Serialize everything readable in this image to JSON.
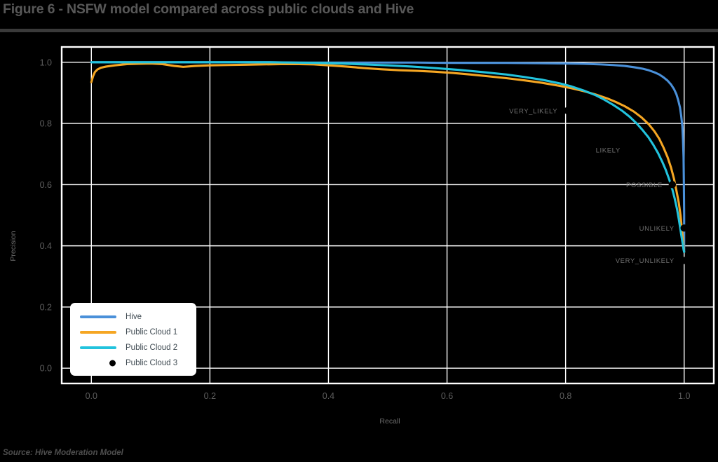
{
  "figure": {
    "title": "Figure 6 - NSFW model compared across public clouds and Hive",
    "source": "Source: Hive Moderation Model"
  },
  "colors": {
    "hive": "#4a90d9",
    "public_cloud_1": "#f5a623",
    "public_cloud_2": "#22c3dd",
    "public_cloud_3": "#000000",
    "background": "#000000",
    "axis": "#ffffff",
    "title_text": "#585858",
    "tick_text": "#5e5e5e",
    "annotation_text": "#707070",
    "legend_background": "#ffffff",
    "legend_text": "#3f4a52"
  },
  "legend": {
    "position": "lower-left",
    "entries": [
      {
        "label": "Hive",
        "marker": "line",
        "color": "#4a90d9"
      },
      {
        "label": "Public Cloud 1",
        "marker": "line",
        "color": "#f5a623"
      },
      {
        "label": "Public Cloud 2",
        "marker": "line",
        "color": "#22c3dd"
      },
      {
        "label": "Public Cloud 3",
        "marker": "dot",
        "color": "#000000"
      }
    ]
  },
  "chart_data": {
    "type": "line",
    "title": "Figure 6 - NSFW model compared across public clouds and Hive",
    "subtitle": "",
    "xlabel": "Recall",
    "ylabel": "Precision",
    "xlim": [
      -0.05,
      1.05
    ],
    "ylim": [
      -0.05,
      1.05
    ],
    "xticks": [
      "0.0",
      "0.2",
      "0.4",
      "0.6",
      "0.8",
      "1.0"
    ],
    "xtick_values": [
      0.0,
      0.2,
      0.4,
      0.6,
      0.8,
      1.0
    ],
    "yticks": [
      "0.0",
      "0.2",
      "0.4",
      "0.6",
      "0.8",
      "1.0"
    ],
    "ytick_values": [
      0.0,
      0.2,
      0.4,
      0.6,
      0.8,
      1.0
    ],
    "grid": true,
    "grid_color": "#ffffff",
    "legend_position": "lower left",
    "series": [
      {
        "name": "Hive",
        "color": "#4a90d9",
        "type": "line",
        "points": [
          [
            0.0,
            1.0
          ],
          [
            0.05,
            1.0
          ],
          [
            0.1,
            1.0
          ],
          [
            0.15,
            1.0
          ],
          [
            0.2,
            1.0
          ],
          [
            0.25,
            1.0
          ],
          [
            0.3,
            1.0
          ],
          [
            0.35,
            0.999
          ],
          [
            0.4,
            0.999
          ],
          [
            0.45,
            0.999
          ],
          [
            0.5,
            0.999
          ],
          [
            0.55,
            0.999
          ],
          [
            0.6,
            0.998
          ],
          [
            0.65,
            0.998
          ],
          [
            0.7,
            0.998
          ],
          [
            0.75,
            0.997
          ],
          [
            0.8,
            0.996
          ],
          [
            0.83,
            0.995
          ],
          [
            0.86,
            0.993
          ],
          [
            0.88,
            0.991
          ],
          [
            0.9,
            0.988
          ],
          [
            0.915,
            0.984
          ],
          [
            0.93,
            0.979
          ],
          [
            0.94,
            0.974
          ],
          [
            0.95,
            0.967
          ],
          [
            0.958,
            0.96
          ],
          [
            0.965,
            0.951
          ],
          [
            0.972,
            0.94
          ],
          [
            0.978,
            0.927
          ],
          [
            0.983,
            0.912
          ],
          [
            0.987,
            0.895
          ],
          [
            0.99,
            0.876
          ],
          [
            0.993,
            0.852
          ],
          [
            0.995,
            0.825
          ],
          [
            0.997,
            0.79
          ],
          [
            0.998,
            0.748
          ],
          [
            0.999,
            0.69
          ],
          [
            0.9995,
            0.61
          ],
          [
            1.0,
            0.5
          ],
          [
            1.0,
            0.38
          ]
        ]
      },
      {
        "name": "Public Cloud 1",
        "color": "#f5a623",
        "type": "line",
        "points": [
          [
            0.0,
            0.935
          ],
          [
            0.003,
            0.955
          ],
          [
            0.006,
            0.968
          ],
          [
            0.01,
            0.976
          ],
          [
            0.016,
            0.982
          ],
          [
            0.025,
            0.986
          ],
          [
            0.04,
            0.99
          ],
          [
            0.06,
            0.994
          ],
          [
            0.08,
            0.995
          ],
          [
            0.1,
            0.996
          ],
          [
            0.12,
            0.994
          ],
          [
            0.14,
            0.988
          ],
          [
            0.155,
            0.985
          ],
          [
            0.175,
            0.988
          ],
          [
            0.2,
            0.99
          ],
          [
            0.23,
            0.991
          ],
          [
            0.26,
            0.992
          ],
          [
            0.29,
            0.993
          ],
          [
            0.32,
            0.994
          ],
          [
            0.35,
            0.994
          ],
          [
            0.375,
            0.993
          ],
          [
            0.4,
            0.99
          ],
          [
            0.43,
            0.986
          ],
          [
            0.46,
            0.981
          ],
          [
            0.49,
            0.977
          ],
          [
            0.52,
            0.974
          ],
          [
            0.55,
            0.972
          ],
          [
            0.58,
            0.969
          ],
          [
            0.61,
            0.965
          ],
          [
            0.64,
            0.96
          ],
          [
            0.67,
            0.954
          ],
          [
            0.7,
            0.948
          ],
          [
            0.73,
            0.941
          ],
          [
            0.76,
            0.933
          ],
          [
            0.79,
            0.923
          ],
          [
            0.81,
            0.915
          ],
          [
            0.83,
            0.906
          ],
          [
            0.85,
            0.895
          ],
          [
            0.87,
            0.882
          ],
          [
            0.885,
            0.87
          ],
          [
            0.9,
            0.856
          ],
          [
            0.915,
            0.839
          ],
          [
            0.928,
            0.82
          ],
          [
            0.94,
            0.798
          ],
          [
            0.95,
            0.774
          ],
          [
            0.958,
            0.75
          ],
          [
            0.965,
            0.722
          ],
          [
            0.972,
            0.69
          ],
          [
            0.978,
            0.655
          ],
          [
            0.983,
            0.618
          ],
          [
            0.987,
            0.58
          ],
          [
            0.991,
            0.54
          ],
          [
            0.994,
            0.498
          ],
          [
            0.996,
            0.458
          ],
          [
            0.998,
            0.42
          ],
          [
            0.999,
            0.395
          ],
          [
            1.0,
            0.38
          ]
        ]
      },
      {
        "name": "Public Cloud 2",
        "color": "#22c3dd",
        "type": "line",
        "points": [
          [
            0.0,
            1.0
          ],
          [
            0.05,
            1.0
          ],
          [
            0.1,
            1.0
          ],
          [
            0.15,
            1.0
          ],
          [
            0.2,
            1.0
          ],
          [
            0.25,
            1.0
          ],
          [
            0.3,
            1.0
          ],
          [
            0.34,
            0.999
          ],
          [
            0.38,
            0.998
          ],
          [
            0.42,
            0.996
          ],
          [
            0.46,
            0.993
          ],
          [
            0.5,
            0.99
          ],
          [
            0.54,
            0.986
          ],
          [
            0.58,
            0.981
          ],
          [
            0.62,
            0.975
          ],
          [
            0.66,
            0.968
          ],
          [
            0.7,
            0.96
          ],
          [
            0.73,
            0.952
          ],
          [
            0.76,
            0.943
          ],
          [
            0.79,
            0.931
          ],
          [
            0.81,
            0.921
          ],
          [
            0.83,
            0.908
          ],
          [
            0.85,
            0.893
          ],
          [
            0.865,
            0.878
          ],
          [
            0.88,
            0.861
          ],
          [
            0.895,
            0.842
          ],
          [
            0.908,
            0.822
          ],
          [
            0.92,
            0.8
          ],
          [
            0.93,
            0.778
          ],
          [
            0.94,
            0.754
          ],
          [
            0.948,
            0.73
          ],
          [
            0.956,
            0.703
          ],
          [
            0.963,
            0.675
          ],
          [
            0.969,
            0.648
          ],
          [
            0.975,
            0.616
          ],
          [
            0.98,
            0.585
          ],
          [
            0.984,
            0.555
          ],
          [
            0.988,
            0.52
          ],
          [
            0.991,
            0.487
          ],
          [
            0.994,
            0.45
          ],
          [
            0.996,
            0.425
          ],
          [
            0.998,
            0.402
          ],
          [
            0.999,
            0.388
          ],
          [
            1.0,
            0.38
          ]
        ]
      },
      {
        "name": "Public Cloud 3",
        "color": "#000000",
        "type": "scatter",
        "points": [
          [
            0.803,
            0.842
          ],
          [
            0.909,
            0.713
          ],
          [
            0.98,
            0.6
          ],
          [
            1.0,
            0.458
          ],
          [
            1.0,
            0.352
          ]
        ],
        "point_labels": [
          "VERY_LIKELY",
          "LIKELY",
          "POSSIBLE",
          "UNLIKELY",
          "VERY_UNLIKELY"
        ]
      }
    ],
    "annotations": [
      {
        "text": "VERY_LIKELY",
        "x": 0.803,
        "y": 0.842
      },
      {
        "text": "LIKELY",
        "x": 0.909,
        "y": 0.713
      },
      {
        "text": "POSSIBLE",
        "x": 0.98,
        "y": 0.6
      },
      {
        "text": "UNLIKELY",
        "x": 1.0,
        "y": 0.458
      },
      {
        "text": "VERY_UNLIKELY",
        "x": 1.0,
        "y": 0.352
      }
    ]
  }
}
